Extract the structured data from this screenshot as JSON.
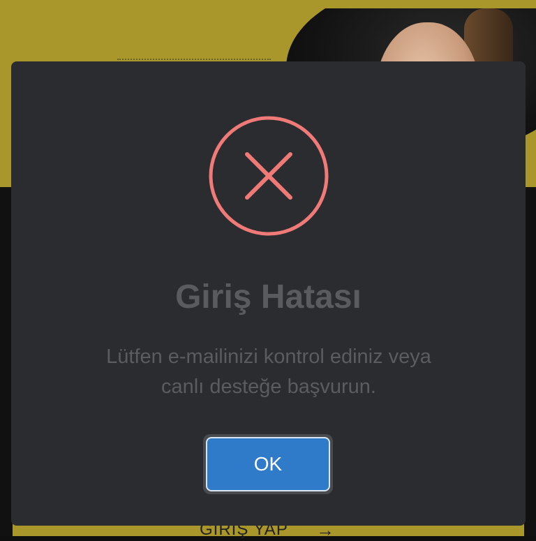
{
  "background": {
    "login_button_label": "GİRİŞ YAP",
    "login_arrow": "→",
    "accent_color": "#a9972b"
  },
  "dialog": {
    "icon": "error-x-circle-icon",
    "icon_color": "#f07a78",
    "title": "Giriş Hatası",
    "message": "Lütfen e-mailinizi kontrol ediniz veya canlı desteğe başvurun.",
    "ok_label": "OK",
    "ok_color": "#2f7bc9"
  }
}
